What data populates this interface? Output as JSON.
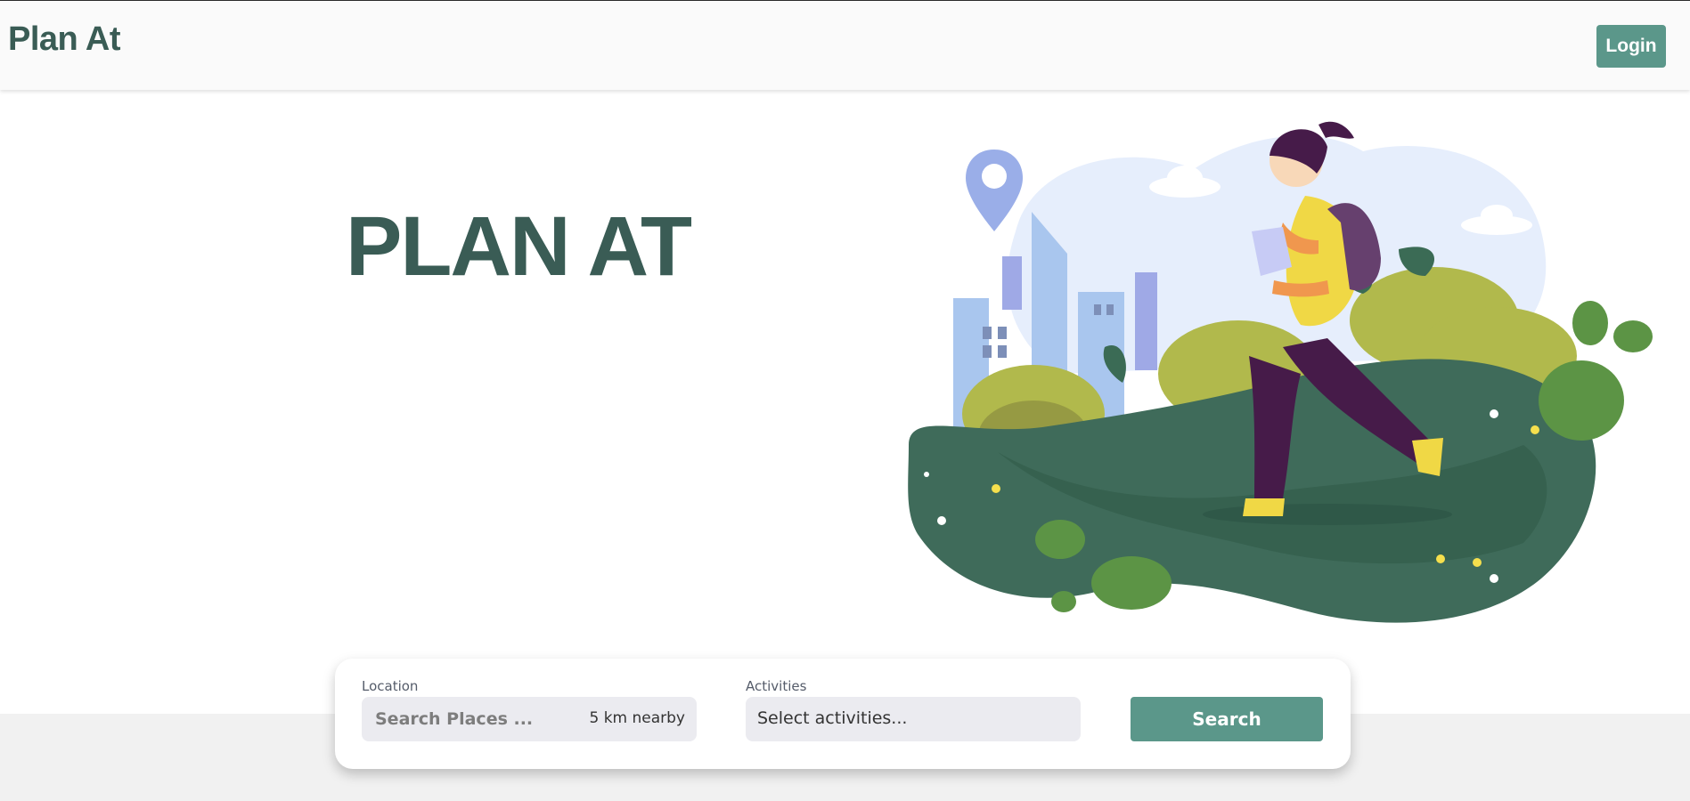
{
  "navbar": {
    "brand": "Plan At",
    "login_label": "Login"
  },
  "hero": {
    "title": "PLAN AT",
    "illustration_icon": "hiker-with-map-illustration"
  },
  "search": {
    "location_label": "Location",
    "location_placeholder": "Search Places ...",
    "radius_text": "5 km nearby",
    "activities_label": "Activities",
    "activities_placeholder": "Select activities...",
    "button_label": "Search"
  },
  "colors": {
    "brand": "#3a5c55",
    "accent": "#5b978a",
    "input_bg": "#ebebf0",
    "page_bg": "#f1f1f1"
  }
}
